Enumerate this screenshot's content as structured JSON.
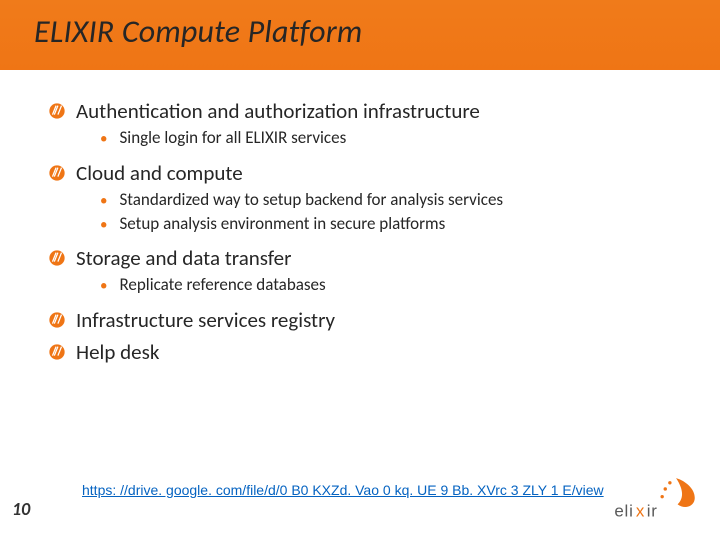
{
  "title": "ELIXIR Compute Platform",
  "bullets": [
    {
      "text": "Authentication and authorization infrastructure",
      "subs": [
        "Single login for all ELIXIR services"
      ]
    },
    {
      "text": "Cloud and compute",
      "subs": [
        "Standardized way to setup backend for analysis services",
        "Setup analysis environment in secure platforms"
      ]
    },
    {
      "text": "Storage and data transfer",
      "subs": [
        "Replicate reference databases"
      ]
    },
    {
      "text": "Infrastructure services registry",
      "subs": []
    },
    {
      "text": "Help desk",
      "subs": []
    }
  ],
  "link": "https: //drive. google. com/file/d/0 B0 KXZd. Vao 0 kq. UE 9 Bb. XVrc 3 ZLY 1 E/view",
  "page_number": "10",
  "logo_name": "elixir"
}
